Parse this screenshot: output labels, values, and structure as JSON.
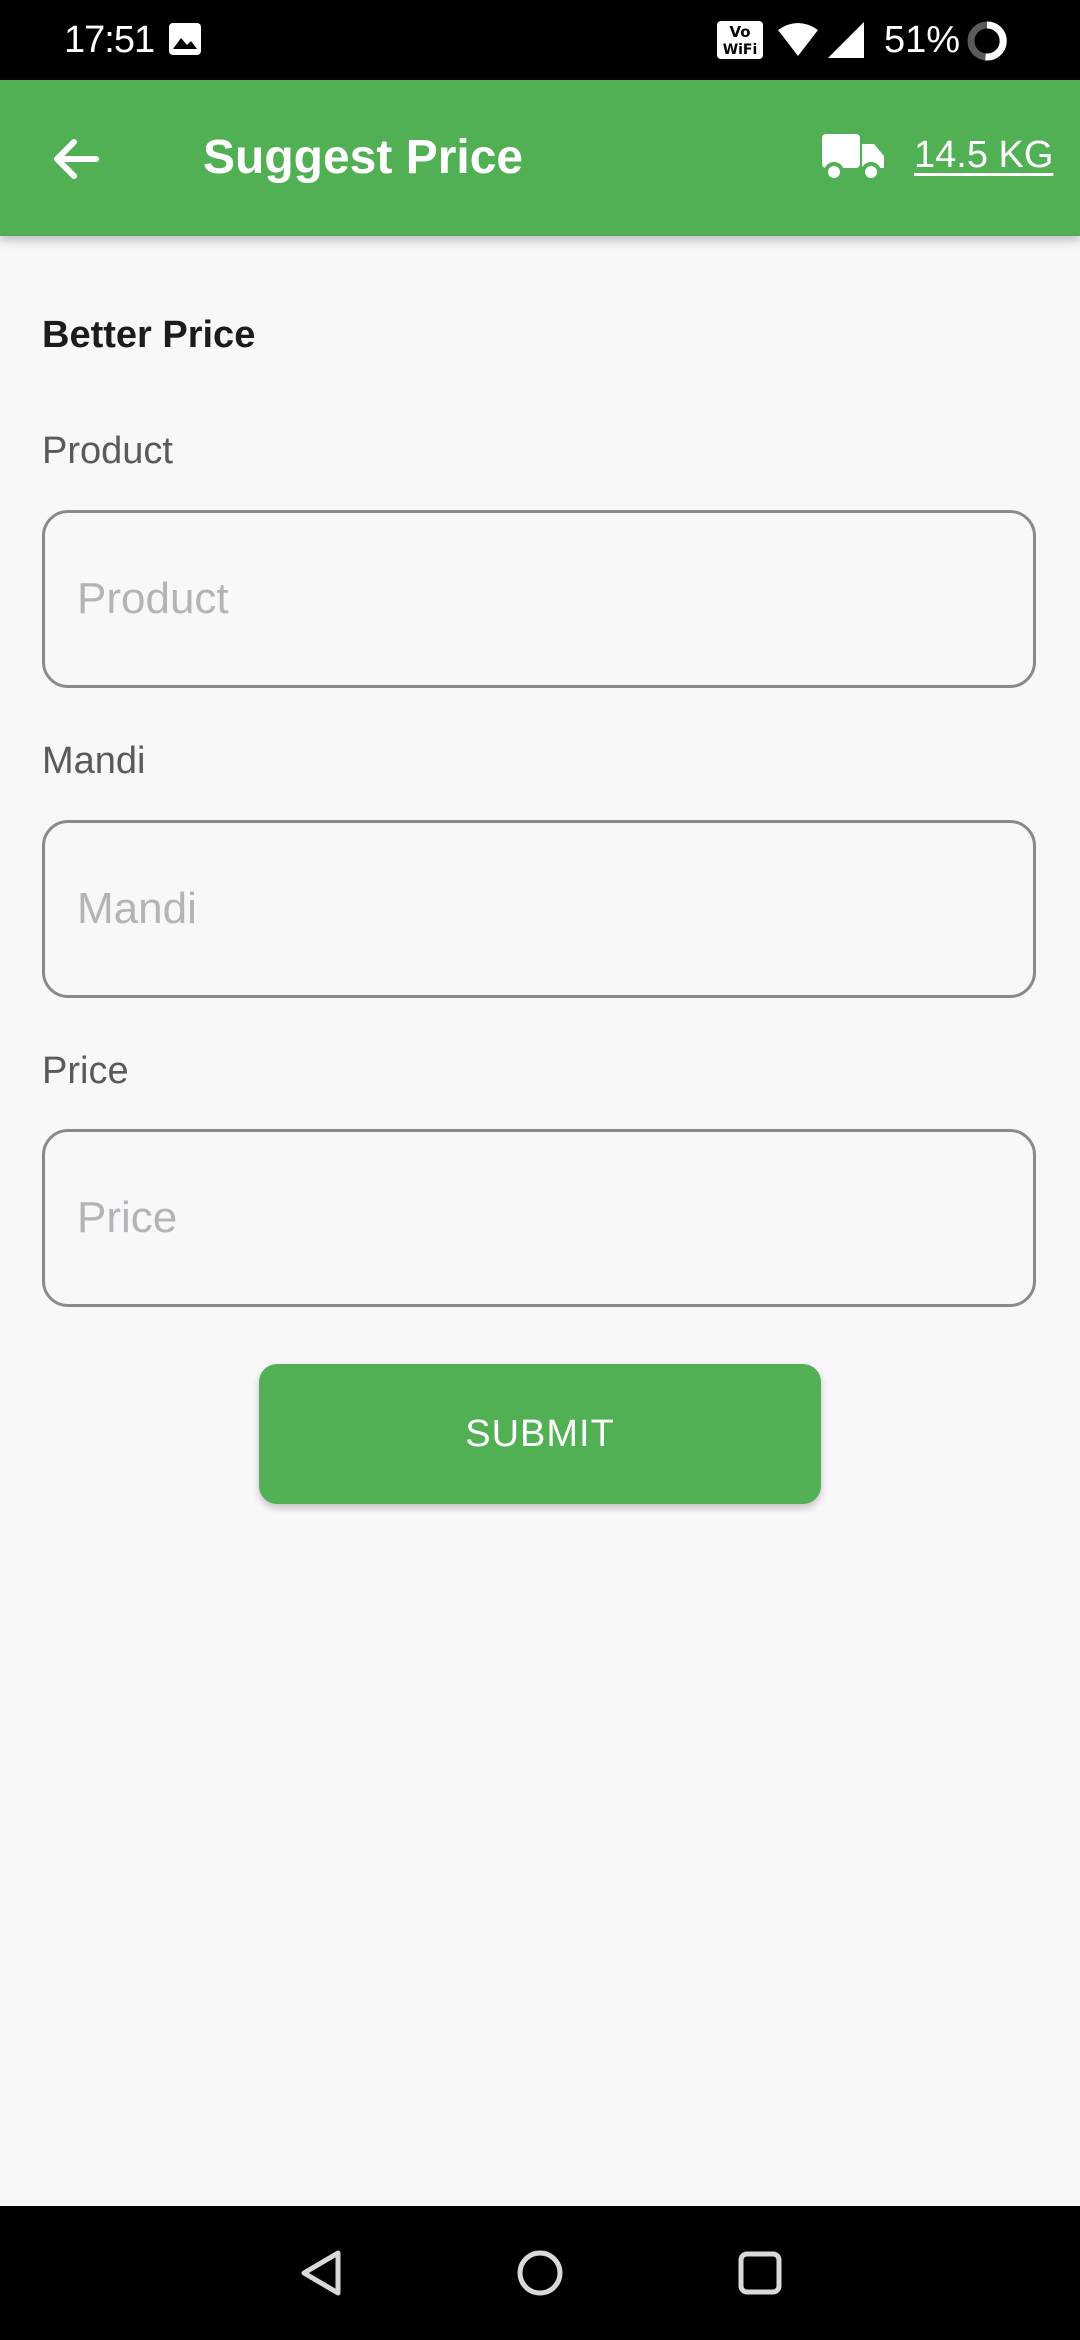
{
  "status_bar": {
    "time": "17:51",
    "battery": "51%",
    "icons": [
      "gallery-icon",
      "vowifi-icon",
      "wifi-icon",
      "signal-icon",
      "battery-icon"
    ]
  },
  "app_bar": {
    "title": "Suggest Price",
    "weight": "14.5 KG",
    "color": "#52b054",
    "icons": [
      "back-arrow-icon",
      "truck-icon"
    ]
  },
  "form": {
    "section_title": "Better Price",
    "fields": [
      {
        "label": "Product",
        "placeholder": "Product",
        "value": ""
      },
      {
        "label": "Mandi",
        "placeholder": "Mandi",
        "value": ""
      },
      {
        "label": "Price",
        "placeholder": "Price",
        "value": ""
      }
    ],
    "submit_label": "SUBMIT"
  },
  "nav_bar": {
    "icons": [
      "back-triangle-icon",
      "home-circle-icon",
      "recents-square-icon"
    ]
  }
}
